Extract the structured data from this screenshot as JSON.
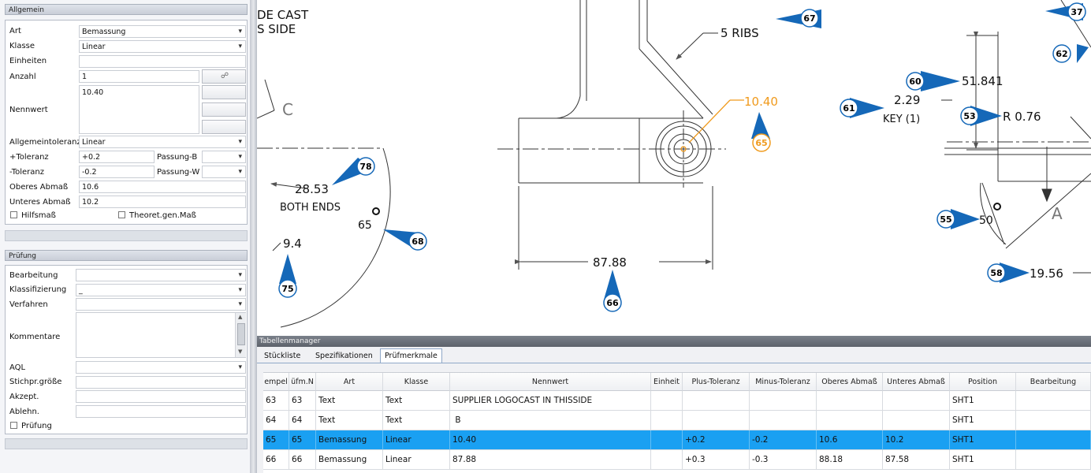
{
  "colors": {
    "selection": "#1aa0f2",
    "balloon": "#1568b8",
    "highlight": "#f09a1c"
  },
  "allgemein": {
    "title": "Allgemein",
    "art": {
      "label": "Art",
      "value": "Bemassung"
    },
    "klasse": {
      "label": "Klasse",
      "value": "Linear"
    },
    "einheiten": {
      "label": "Einheiten",
      "value": ""
    },
    "anzahl": {
      "label": "Anzahl",
      "value": "1"
    },
    "nennwert": {
      "label": "Nennwert",
      "value": "10.40"
    },
    "allgemeintoleranz": {
      "label": "Allgemeintoleranz",
      "value": "Linear"
    },
    "plus_toleranz": {
      "label": "+Toleranz",
      "value": "+0.2"
    },
    "passung_b": {
      "label": "Passung-B",
      "value": ""
    },
    "minus_toleranz": {
      "label": "-Toleranz",
      "value": "-0.2"
    },
    "passung_w": {
      "label": "Passung-W",
      "value": ""
    },
    "oberes_abmass": {
      "label": "Oberes Abmaß",
      "value": "10.6"
    },
    "unteres_abmass": {
      "label": "Unteres Abmaß",
      "value": "10.2"
    },
    "hilfsmass": {
      "label": "Hilfsmaß"
    },
    "theoret": {
      "label": "Theoret.gen.Maß"
    }
  },
  "pruefung": {
    "title": "Prüfung",
    "bearbeitung": {
      "label": "Bearbeitung",
      "value": ""
    },
    "klassifizierung": {
      "label": "Klassifizierung",
      "value": "_"
    },
    "verfahren": {
      "label": "Verfahren",
      "value": ""
    },
    "kommentare": {
      "label": "Kommentare",
      "value": ""
    },
    "aql": {
      "label": "AQL",
      "value": ""
    },
    "stichpr": {
      "label": "Stichpr.größe",
      "value": ""
    },
    "akzept": {
      "label": "Akzept.",
      "value": ""
    },
    "ablehn": {
      "label": "Ablehn.",
      "value": ""
    },
    "pruefung_chk": {
      "label": "Prüfung"
    }
  },
  "drawing": {
    "notes": [
      "DE CAST",
      "S SIDE"
    ],
    "ribs": "5 RIBS",
    "dim_2853": "28.53",
    "both_ends": "BOTH ENDS",
    "dim_65": "65",
    "dim_94": "9.4",
    "dim_8788": "87.88",
    "dim_1040": "10.40",
    "dim_51841": "51.841",
    "dim_229": "2.29",
    "key": "KEY (1)",
    "dim_r076": "R 0.76",
    "dim_50": "50",
    "dim_1956": "19.56",
    "label_c": "C",
    "label_a": "A",
    "balloons": {
      "b37": "37",
      "b62": "62",
      "b67": "67",
      "b78": "78",
      "b68": "68",
      "b75": "75",
      "b66": "66",
      "b65": "65",
      "b60": "60",
      "b61": "61",
      "b53": "53",
      "b55": "55",
      "b58": "58"
    }
  },
  "table_manager": {
    "title": "Tabellenmanager",
    "tabs": [
      "Stückliste",
      "Spezifikationen",
      "Prüfmerkmale"
    ],
    "columns": [
      "empel",
      "üfm.N",
      "Art",
      "Klasse",
      "Nennwert",
      "Einheit",
      "Plus-Toleranz",
      "Minus-Toleranz",
      "Oberes Abmaß",
      "Unteres Abmaß",
      "Position",
      "Bearbeitung"
    ],
    "rows": [
      [
        "63",
        "63",
        "Text",
        "Text",
        "SUPPLIER LOGOCAST IN THISSIDE",
        "",
        "",
        "",
        "",
        "",
        "SHT1",
        ""
      ],
      [
        "64",
        "64",
        "Text",
        "Text",
        " B",
        "",
        "",
        "",
        "",
        "",
        "SHT1",
        ""
      ],
      [
        "65",
        "65",
        "Bemassung",
        "Linear",
        "10.40",
        "",
        "+0.2",
        "-0.2",
        "10.6",
        "10.2",
        "SHT1",
        ""
      ],
      [
        "66",
        "66",
        "Bemassung",
        "Linear",
        "87.88",
        "",
        "+0.3",
        "-0.3",
        "88.18",
        "87.58",
        "SHT1",
        ""
      ]
    ]
  }
}
